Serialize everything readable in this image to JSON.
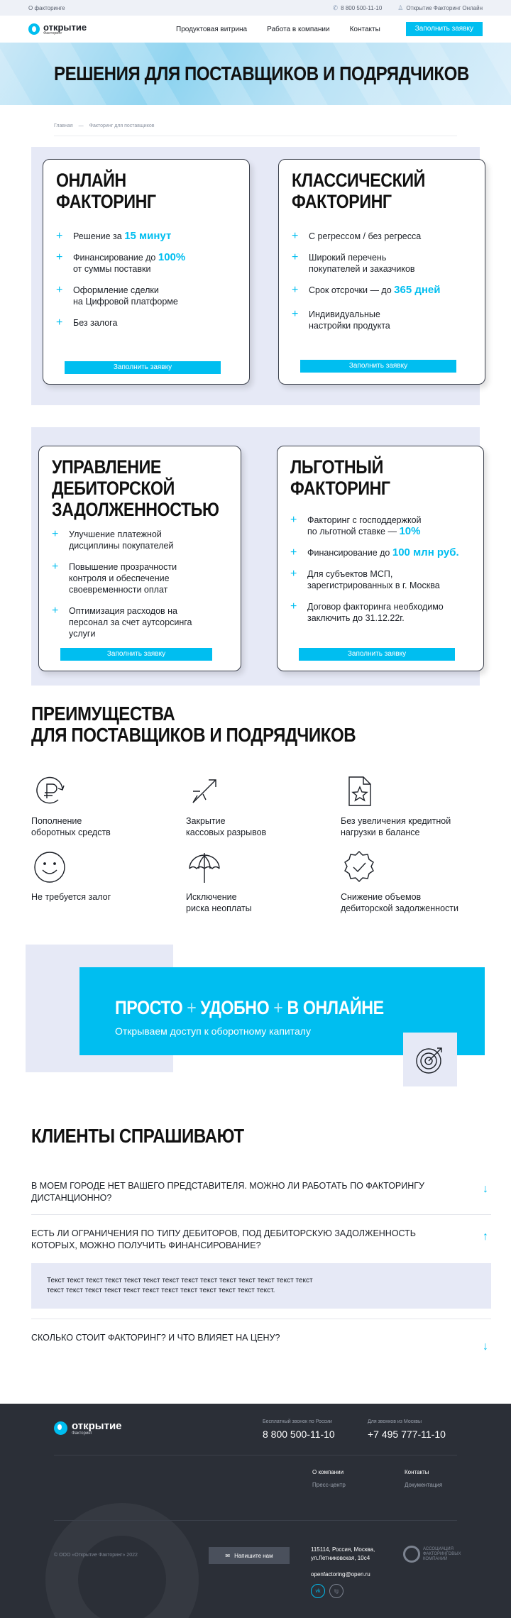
{
  "topbar": {
    "about": "О факторинге",
    "phone": "8 800 500-11-10",
    "online": "Открытие Факторинг Онлайн"
  },
  "header": {
    "logo_name": "открытие",
    "logo_sub": "Факторинг",
    "nav": [
      "Продуктовая витрина",
      "Работа в компании",
      "Контакты"
    ],
    "cta": "Заполнить заявку"
  },
  "hero": {
    "title": "Решения для поставщиков и подрядчиков"
  },
  "breadcrumbs": [
    "Главная",
    "—",
    "Факторинг для поставщиков"
  ],
  "offers": {
    "online": {
      "title": [
        "Онлайн",
        "факторинг"
      ],
      "items": [
        {
          "text": "Решение за ",
          "accent": "15 минут"
        },
        {
          "text": "Финансирование до ",
          "accent": "100%",
          "text2": "от суммы поставки"
        },
        {
          "text": "Оформление сделки",
          "text2": "на Цифровой платформе"
        },
        {
          "text": "Без залога"
        }
      ],
      "button": "Заполнить заявку"
    },
    "classic": {
      "title": [
        "Классический",
        "факторинг"
      ],
      "items": [
        {
          "text": "С регрессом /  без регресса"
        },
        {
          "text": "Широкий перечень",
          "text2": "покупателей и заказчиков"
        },
        {
          "text": "Срок отсрочки — до ",
          "accent": "365 дней"
        },
        {
          "text": "Индивидуальные",
          "text2": "настройки продукта"
        }
      ],
      "button": "Заполнить заявку"
    },
    "receivables": {
      "title": [
        "Управление",
        "дебиторской",
        "задолженностью"
      ],
      "items": [
        {
          "text": "Улучшение платежной",
          "text2": "дисциплины покупателей"
        },
        {
          "text": "Повышение прозрачности",
          "text2": "контроля и обеспечение",
          "text3": "своевременности оплат"
        },
        {
          "text": "Оптимизация расходов на",
          "text2": "персонал за счет аутсорсинга",
          "text3": "услуги"
        }
      ],
      "button": "Заполнить заявку"
    },
    "preferential": {
      "title": [
        "Льготный",
        "факторинг"
      ],
      "items": [
        {
          "text": "Факторинг с господдержкой",
          "text2": "по льготной ставке — ",
          "accent": "10%"
        },
        {
          "text": "Финансирование до ",
          "accent": "100 млн руб."
        },
        {
          "text": "Для субъектов МСП,",
          "text2": "зарегистрированных в г. Москва"
        },
        {
          "text": "Договор факторинга необходимо",
          "text2": "заключить до 31.12.22г."
        }
      ],
      "button": "Заполнить заявку"
    }
  },
  "advantages": {
    "title": [
      "Преимущества",
      "для поставщиков и подрядчиков"
    ],
    "items": [
      {
        "icon": "ruble-refresh-icon",
        "lines": [
          "Пополнение",
          "оборотных средств"
        ]
      },
      {
        "icon": "arrows-icon",
        "lines": [
          "Закрытие",
          "кассовых разрывов"
        ]
      },
      {
        "icon": "document-star-icon",
        "lines": [
          "Без увеличения кредитной",
          "нагрузки в балансе"
        ]
      },
      {
        "icon": "smile-icon",
        "lines": [
          "Не требуется залог"
        ]
      },
      {
        "icon": "umbrella-icon",
        "lines": [
          "Исключение",
          "риска неоплаты"
        ]
      },
      {
        "icon": "badge-check-icon",
        "lines": [
          "Снижение объемов",
          "дебиторской задолженности"
        ]
      }
    ]
  },
  "promo": {
    "words": [
      "Просто",
      "удобно",
      "в онлайне"
    ],
    "subtitle": "Открываем доступ к оборотному капиталу",
    "icon": "target-icon"
  },
  "faq": {
    "title": "Клиенты спрашивают",
    "items": [
      {
        "q": "В моем городе нет вашего представителя. Можно ли работать по факторингу дистанционно?",
        "open": false
      },
      {
        "q": "Есть ли ограничения по типу дебиторов, под дебиторскую задолженность которых, можно получить финансирование?",
        "open": true,
        "a": "Текст текст текст текст текст текст текст текст текст текст текст текст текст текст текст текст текст текст текст текст текст текст текст текст текст текст."
      },
      {
        "q": "Сколько стоит факторинг? И что влияет на цену?",
        "open": false
      }
    ]
  },
  "footer": {
    "logo_name": "открытие",
    "logo_sub": "Факторинг",
    "free_label": "Бесплатный звонок по России",
    "free_phone": "8 800 500-11-10",
    "moscow_label": "Для звонков из Москвы",
    "moscow_phone": "+7 495 777-11-10",
    "links": [
      "О компании",
      "Контакты",
      "Пресс-центр",
      "Документация"
    ],
    "copyright": "© ООО «Открытие Факторинг» 2022",
    "write_us": "Напишите нам",
    "address": [
      "115114, Россия, Москва,",
      "ул.Летниковская, 10с4"
    ],
    "email": "openfactoring@open.ru",
    "socials": [
      "vk",
      "tg"
    ],
    "association": [
      "Ассоциация",
      "факторинговых",
      "компаний"
    ],
    "colors": {
      "accent": "#00bef0",
      "footer_bg": "#2b2f37",
      "panel_bg": "#e6e9f6"
    }
  }
}
